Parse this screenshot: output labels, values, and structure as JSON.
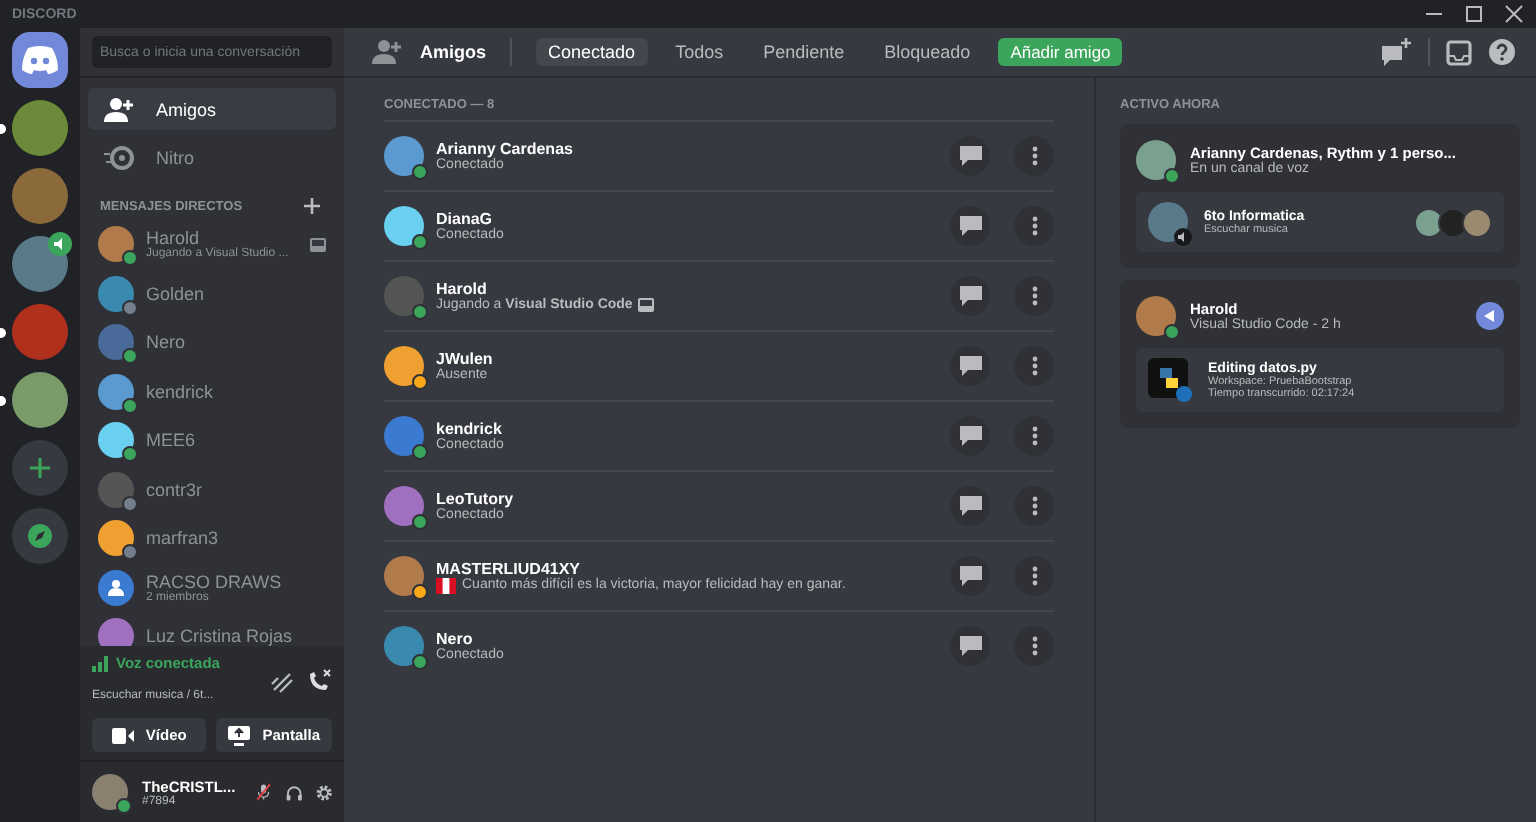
{
  "window": {
    "title": "DISCORD"
  },
  "servers": [
    {
      "unread": true,
      "voice": false,
      "color": "#6b8a3a"
    },
    {
      "unread": false,
      "voice": false,
      "color": "#8a6a3a"
    },
    {
      "unread": false,
      "voice": true,
      "color": "#5a7a8a"
    },
    {
      "unread": true,
      "voice": false,
      "color": "#b0301e"
    },
    {
      "unread": true,
      "voice": false,
      "color": "#7a9a6a"
    }
  ],
  "search": {
    "placeholder": "Busca o inicia una conversación"
  },
  "nav": [
    {
      "kind": "friends",
      "label": "Amigos",
      "selected": true
    },
    {
      "kind": "nitro",
      "label": "Nitro",
      "selected": false
    }
  ],
  "dm_header": "MENSAJES DIRECTOS",
  "dms": [
    {
      "name": "Harold",
      "subtitle": "Jugando a Visual Studio ...",
      "kind": "user",
      "color": "#3ba55c",
      "rich": true
    },
    {
      "name": "Golden",
      "kind": "user",
      "color": "#747f8d",
      "rich": false
    },
    {
      "name": "Nero",
      "kind": "user",
      "color": "#3ba55c",
      "rich": false
    },
    {
      "name": "kendrick",
      "kind": "user",
      "color": "#3ba55c",
      "rich": false
    },
    {
      "name": "MEE6",
      "kind": "user",
      "color": "#3ba55c",
      "rich": false
    },
    {
      "name": "contr3r",
      "kind": "user",
      "color": "#747f8d",
      "rich": false
    },
    {
      "name": "marfran3",
      "kind": "user",
      "color": "#747f8d",
      "rich": false
    },
    {
      "name": "RACSO DRAWS",
      "subtitle": "2 miembros",
      "kind": "group",
      "rich": false
    },
    {
      "name": "Luz Cristina Rojas",
      "kind": "plain",
      "rich": false
    }
  ],
  "voice": {
    "title": "Voz conectada",
    "channel": "Escuchar musica / 6t...",
    "buttons": [
      "Vídeo",
      "Pantalla"
    ]
  },
  "user": {
    "name": "TheCRISTL...",
    "tag": "#7894",
    "color": "#3ba55c"
  },
  "header": {
    "title": "Amigos",
    "tabs": [
      {
        "label": "Conectado",
        "kind": "tab",
        "selected": true
      },
      {
        "label": "Todos",
        "kind": "tab",
        "selected": false
      },
      {
        "label": "Pendiente",
        "kind": "tab",
        "selected": false
      },
      {
        "label": "Bloqueado",
        "kind": "tab",
        "selected": false
      },
      {
        "label": "Añadir amigo",
        "kind": "add",
        "selected": false
      }
    ]
  },
  "friends_header": "CONECTADO — 8",
  "friends": [
    {
      "name": "Arianny Cardenas",
      "status_text": "Conectado",
      "color": "#3ba55c"
    },
    {
      "name": "DianaG",
      "status_text": "Conectado",
      "color": "#3ba55c"
    },
    {
      "name": "Harold",
      "status_text": "Jugando a **Visual Studio Code**",
      "color": "#3ba55c",
      "rich": true
    },
    {
      "name": "JWulen",
      "status_text": "Ausente",
      "color": "#faa81a"
    },
    {
      "name": "kendrick",
      "status_text": "Conectado",
      "color": "#3ba55c"
    },
    {
      "name": "LeoTutory",
      "status_text": "Conectado",
      "color": "#3ba55c"
    },
    {
      "name": "MASTERLIUD41XY",
      "status_text": "Cuanto más difícil es la victoria, mayor felicidad hay en ganar.",
      "color": "#faa81a",
      "flag": true
    },
    {
      "name": "Nero",
      "status_text": "Conectado",
      "color": "#3ba55c"
    }
  ],
  "active_now": {
    "title": "ACTIVO AHORA",
    "cards": [
      {
        "kind": "voice",
        "name": "Arianny Cardenas, Rythm y 1 perso...",
        "subtitle": "En un canal de voz",
        "inner_title": "6to Informatica",
        "inner_sub": "Escuchar musica"
      },
      {
        "kind": "game",
        "name": "Harold",
        "subtitle": "Visual Studio Code - 2 h",
        "inner_title": "Editing datos.py",
        "lines": [
          "Workspace: PruebaBootstrap",
          "Tiempo transcurrido: 02:17:24"
        ]
      }
    ]
  }
}
